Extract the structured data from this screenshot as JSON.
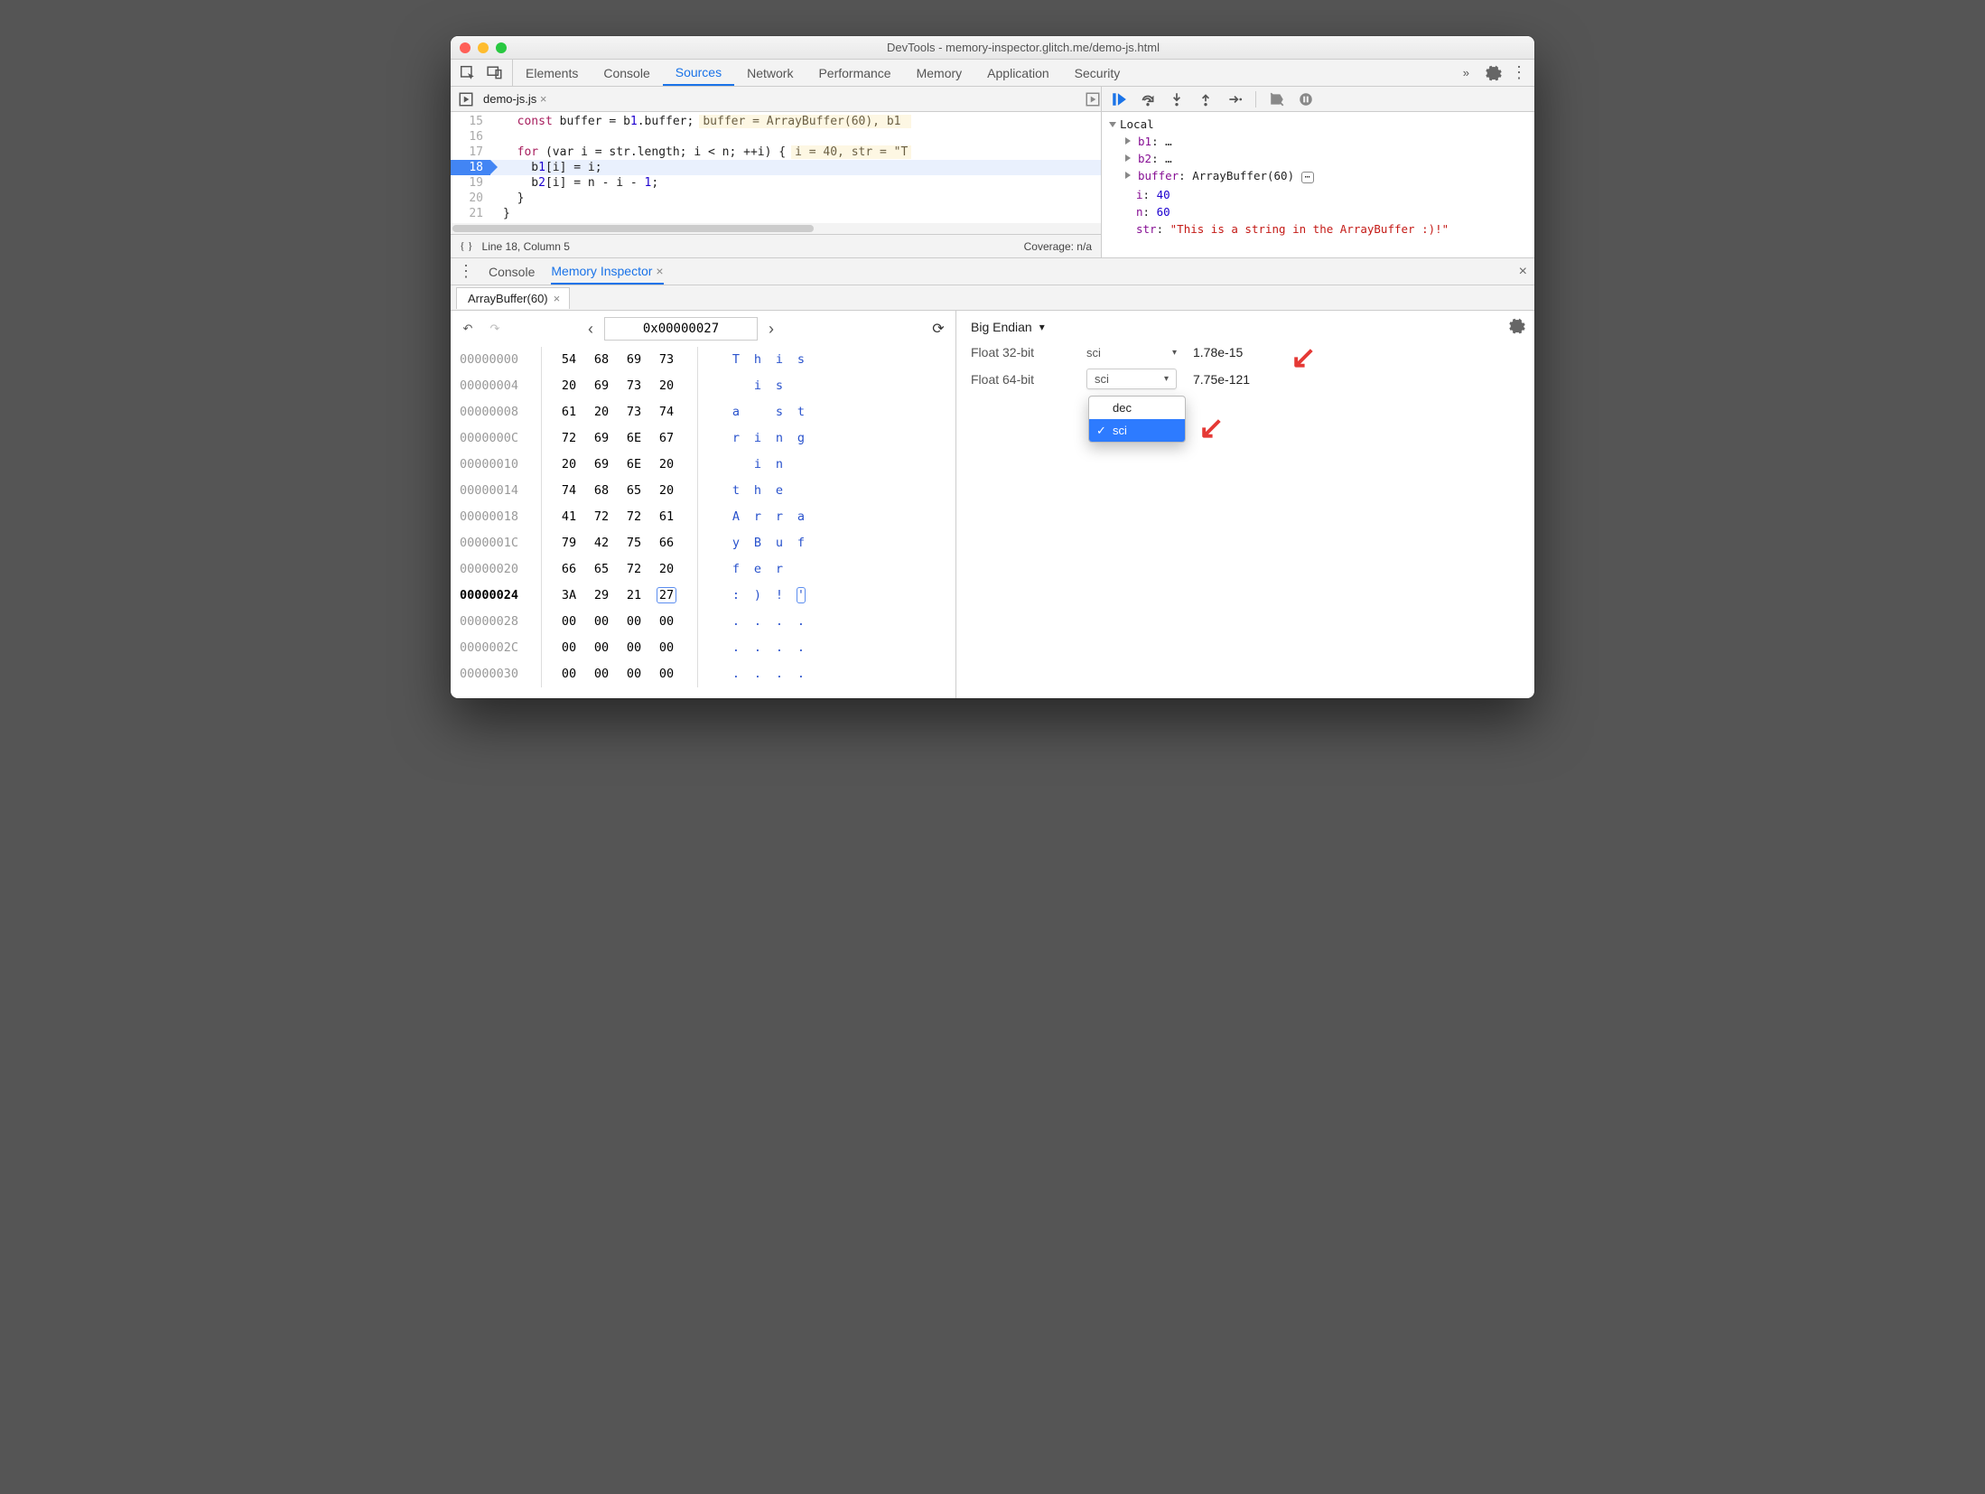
{
  "window": {
    "title": "DevTools - memory-inspector.glitch.me/demo-js.html"
  },
  "top_tabs": [
    "Elements",
    "Console",
    "Sources",
    "Network",
    "Performance",
    "Memory",
    "Application",
    "Security"
  ],
  "top_active": "Sources",
  "src_file": "demo-js.js",
  "editor": {
    "lines": [
      {
        "num": "15",
        "text_prefix": "  ",
        "kw": "const",
        "text": " buffer = b1.buffer;",
        "inline": "buffer = ArrayBuffer(60), b1 "
      },
      {
        "num": "16",
        "text": ""
      },
      {
        "num": "17",
        "kw": "  for",
        "text": " (var i = str.length; i < n; ++i) {",
        "inline": "i = 40, str = \"T"
      },
      {
        "num": "18",
        "text": "    b1[i] = i;",
        "bp": true,
        "hl": true
      },
      {
        "num": "19",
        "text": "    b2[i] = n - i - 1;"
      },
      {
        "num": "20",
        "text": "  }"
      },
      {
        "num": "21",
        "text": "}"
      }
    ]
  },
  "status": {
    "left": "Line 18, Column 5",
    "right": "Coverage: n/a"
  },
  "scope": {
    "header": "Local",
    "entries": [
      {
        "name": "b1",
        "val": "…",
        "exp": true
      },
      {
        "name": "b2",
        "val": "…",
        "exp": true
      },
      {
        "name": "buffer",
        "val": "ArrayBuffer(60)",
        "exp": true,
        "icon": true
      },
      {
        "name": "i",
        "val": "40"
      },
      {
        "name": "n",
        "val": "60"
      },
      {
        "name": "str",
        "val": "\"This is a string in the ArrayBuffer :)!\""
      }
    ]
  },
  "drawer": {
    "tabs": [
      "Console",
      "Memory Inspector"
    ],
    "active": "Memory Inspector",
    "buf_tab": "ArrayBuffer(60)"
  },
  "memory": {
    "address": "0x00000027",
    "rows": [
      {
        "addr": "00000000",
        "b": [
          "54",
          "68",
          "69",
          "73"
        ],
        "a": [
          "T",
          "h",
          "i",
          "s"
        ]
      },
      {
        "addr": "00000004",
        "b": [
          "20",
          "69",
          "73",
          "20"
        ],
        "a": [
          " ",
          "i",
          "s",
          " "
        ]
      },
      {
        "addr": "00000008",
        "b": [
          "61",
          "20",
          "73",
          "74"
        ],
        "a": [
          "a",
          " ",
          "s",
          "t"
        ]
      },
      {
        "addr": "0000000C",
        "b": [
          "72",
          "69",
          "6E",
          "67"
        ],
        "a": [
          "r",
          "i",
          "n",
          "g"
        ]
      },
      {
        "addr": "00000010",
        "b": [
          "20",
          "69",
          "6E",
          "20"
        ],
        "a": [
          " ",
          "i",
          "n",
          " "
        ]
      },
      {
        "addr": "00000014",
        "b": [
          "74",
          "68",
          "65",
          "20"
        ],
        "a": [
          "t",
          "h",
          "e",
          " "
        ]
      },
      {
        "addr": "00000018",
        "b": [
          "41",
          "72",
          "72",
          "61"
        ],
        "a": [
          "A",
          "r",
          "r",
          "a"
        ]
      },
      {
        "addr": "0000001C",
        "b": [
          "79",
          "42",
          "75",
          "66"
        ],
        "a": [
          "y",
          "B",
          "u",
          "f"
        ]
      },
      {
        "addr": "00000020",
        "b": [
          "66",
          "65",
          "72",
          "20"
        ],
        "a": [
          "f",
          "e",
          "r",
          " "
        ]
      },
      {
        "addr": "00000024",
        "b": [
          "3A",
          "29",
          "21",
          "27"
        ],
        "a": [
          ":",
          ")",
          "!",
          "'"
        ],
        "cur": true,
        "hl": 3
      },
      {
        "addr": "00000028",
        "b": [
          "00",
          "00",
          "00",
          "00"
        ],
        "a": [
          ".",
          ".",
          ".",
          "."
        ]
      },
      {
        "addr": "0000002C",
        "b": [
          "00",
          "00",
          "00",
          "00"
        ],
        "a": [
          ".",
          ".",
          ".",
          "."
        ]
      },
      {
        "addr": "00000030",
        "b": [
          "00",
          "00",
          "00",
          "00"
        ],
        "a": [
          ".",
          ".",
          ".",
          "."
        ]
      }
    ]
  },
  "values": {
    "endian": "Big Endian",
    "rows": [
      {
        "label": "Float 32-bit",
        "mode": "sci",
        "value": "1.78e-15"
      },
      {
        "label": "Float 64-bit",
        "mode": "sci",
        "value": "7.75e-121",
        "open": true
      }
    ],
    "dropdown": [
      "dec",
      "sci"
    ],
    "dropdown_sel": "sci"
  }
}
